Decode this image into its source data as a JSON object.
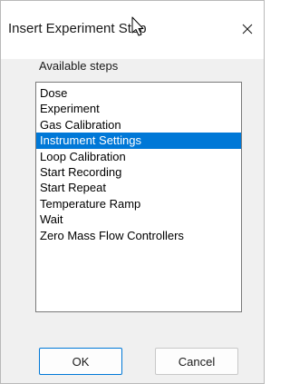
{
  "window": {
    "title": "Insert Experiment Step",
    "close_icon": "close-icon"
  },
  "steps": {
    "label": "Available steps",
    "items": [
      {
        "label": "Dose",
        "selected": false
      },
      {
        "label": "Experiment",
        "selected": false
      },
      {
        "label": "Gas Calibration",
        "selected": false
      },
      {
        "label": "Instrument Settings",
        "selected": true
      },
      {
        "label": "Loop Calibration",
        "selected": false
      },
      {
        "label": "Start Recording",
        "selected": false
      },
      {
        "label": "Start Repeat",
        "selected": false
      },
      {
        "label": "Temperature Ramp",
        "selected": false
      },
      {
        "label": "Wait",
        "selected": false
      },
      {
        "label": "Zero Mass Flow Controllers",
        "selected": false
      }
    ]
  },
  "buttons": {
    "ok_label": "OK",
    "cancel_label": "Cancel"
  },
  "colors": {
    "selection": "#0078d7",
    "dialog_background": "#f0f0f0",
    "titlebar_background": "#ffffff"
  }
}
